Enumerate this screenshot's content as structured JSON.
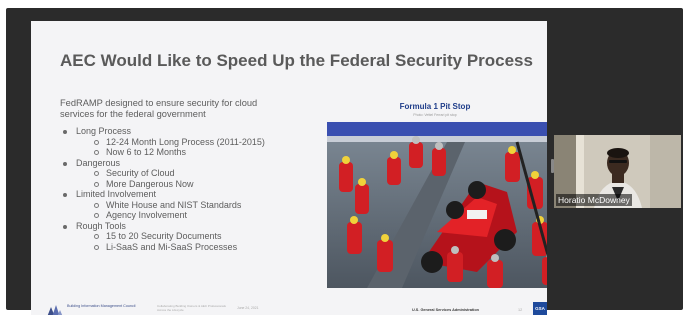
{
  "slide": {
    "title": "AEC Would Like to Speed Up the Federal Security Process",
    "intro": "FedRAMP designed to ensure security for cloud services for the federal government",
    "bullets": [
      {
        "label": "Long Process",
        "sub": [
          "12-24 Month Long Process (2011-2015)",
          "Now 6 to 12 Months"
        ]
      },
      {
        "label": "Dangerous",
        "sub": [
          "Security of Cloud",
          "More Dangerous Now"
        ]
      },
      {
        "label": "Limited Involvement",
        "sub": [
          "White House and NIST Standards",
          "Agency Involvement"
        ]
      },
      {
        "label": "Rough Tools",
        "sub": [
          "15 to 20 Security Documents",
          "Li-SaaS and Mi-SaaS Processes"
        ]
      }
    ],
    "photo": {
      "caption": "Formula 1 Pit Stop",
      "subcaption": "Photo: Vettel Ferrari pit stop"
    },
    "footer": {
      "org": "Building Information Management Council",
      "note": "Collaborating Building Owners & AEC Professionals Across the Lifecycle",
      "date": "June 24, 2021",
      "agency": "U.S. General Services Administration",
      "page": "12",
      "gsa_logo": "GSA"
    }
  },
  "participant": {
    "name": "Horatio McDowney"
  },
  "colors": {
    "stage_bg": "#2b2b2b",
    "slide_bg": "#f4f4f6",
    "title_text": "#5a5a5a",
    "caption_blue": "#1f3d8a",
    "ferrari_red": "#d21f24",
    "gsa_blue": "#1e4a9c"
  }
}
